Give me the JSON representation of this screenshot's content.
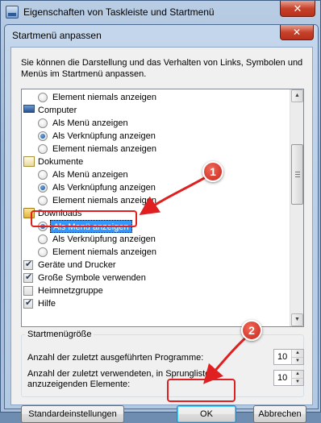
{
  "outer_window": {
    "title": "Eigenschaften von Taskleiste und Startmenü",
    "close_label": "✕"
  },
  "dialog": {
    "title": "Startmenü anpassen",
    "close_label": "✕",
    "description": "Sie können die Darstellung und das Verhalten von Links, Symbolen und Menüs im Startmenü anpassen."
  },
  "list": {
    "rows": [
      {
        "type": "radio",
        "label": "Element niemals anzeigen",
        "checked": false,
        "indent": 1
      },
      {
        "type": "category",
        "label": "Computer",
        "icon": "computer-icon"
      },
      {
        "type": "radio",
        "label": "Als Menü anzeigen",
        "checked": false,
        "indent": 1
      },
      {
        "type": "radio",
        "label": "Als Verknüpfung anzeigen",
        "checked": true,
        "indent": 1
      },
      {
        "type": "radio",
        "label": "Element niemals anzeigen",
        "checked": false,
        "indent": 1
      },
      {
        "type": "category",
        "label": "Dokumente",
        "icon": "documents-icon"
      },
      {
        "type": "radio",
        "label": "Als Menü anzeigen",
        "checked": false,
        "indent": 1
      },
      {
        "type": "radio",
        "label": "Als Verknüpfung anzeigen",
        "checked": true,
        "indent": 1
      },
      {
        "type": "radio",
        "label": "Element niemals anzeigen",
        "checked": false,
        "indent": 1
      },
      {
        "type": "category",
        "label": "Downloads",
        "icon": "downloads-icon"
      },
      {
        "type": "radio",
        "label": "Als Menü anzeigen",
        "checked": true,
        "indent": 1,
        "selected": true
      },
      {
        "type": "radio",
        "label": "Als Verknüpfung anzeigen",
        "checked": false,
        "indent": 1
      },
      {
        "type": "radio",
        "label": "Element niemals anzeigen",
        "checked": false,
        "indent": 1
      },
      {
        "type": "check",
        "label": "Geräte und Drucker",
        "checked": true
      },
      {
        "type": "check",
        "label": "Große Symbole verwenden",
        "checked": true
      },
      {
        "type": "check",
        "label": "Heimnetzgruppe",
        "checked": false
      },
      {
        "type": "check",
        "label": "Hilfe",
        "checked": true
      }
    ]
  },
  "size_group": {
    "title": "Startmenügröße",
    "recent_programs_label": "Anzahl der zuletzt ausgeführten Programme:",
    "recent_programs_value": "10",
    "jumplist_label_line1": "Anzahl der zuletzt verwendeten, in Sprunglisten",
    "jumplist_label_line2": "anzuzeigenden Elemente:",
    "jumplist_value": "10"
  },
  "buttons": {
    "defaults": "Standardeinstellungen",
    "ok": "OK",
    "cancel": "Abbrechen"
  },
  "annotations": {
    "badge1": "1",
    "badge2": "2",
    "accent": "#e02020"
  },
  "colors": {
    "selection": "#3399ff",
    "annotation_red": "#e02020"
  }
}
